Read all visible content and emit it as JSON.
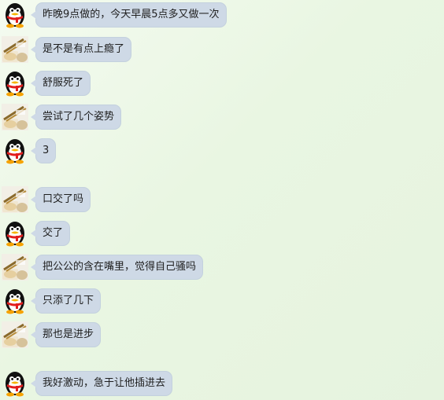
{
  "messages": [
    {
      "sender": "qq-penguin",
      "text": "昨晚9点做的，今天早晨5点多又做一次"
    },
    {
      "sender": "food-photo",
      "text": "是不是有点上瘾了"
    },
    {
      "sender": "qq-penguin",
      "text": "舒服死了"
    },
    {
      "sender": "food-photo",
      "text": "尝试了几个姿势"
    },
    {
      "sender": "qq-penguin",
      "text": "3"
    },
    {
      "sender": "food-photo",
      "text": "口交了吗"
    },
    {
      "sender": "qq-penguin",
      "text": "交了"
    },
    {
      "sender": "food-photo",
      "text": "把公公的含在嘴里，觉得自己骚吗"
    },
    {
      "sender": "qq-penguin",
      "text": "只添了几下"
    },
    {
      "sender": "food-photo",
      "text": "那也是进步"
    },
    {
      "sender": "qq-penguin",
      "text": "我好激动，急于让他插进去"
    }
  ],
  "icons": {
    "penguin": "qq-penguin-avatar-icon",
    "food": "food-photo-avatar-icon"
  },
  "colors": {
    "bubble": "#ced9e6",
    "background": "#eaf6e4"
  }
}
